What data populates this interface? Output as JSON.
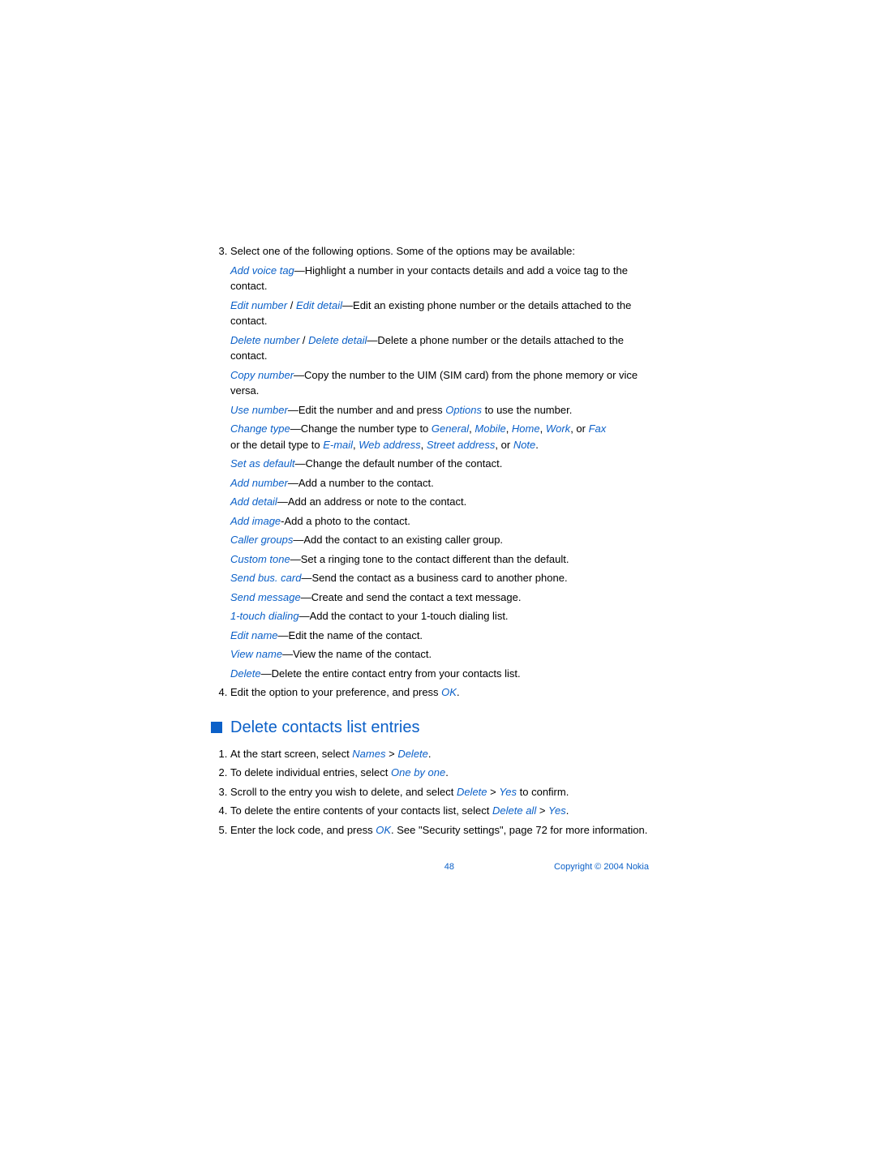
{
  "list3": {
    "intro": "Select one of the following options. Some of the options may be available:"
  },
  "options": [
    {
      "term": "Add voice tag",
      "desc": "—Highlight a number in your contacts details and add a voice tag to the contact."
    },
    {
      "term": "Edit number",
      "sep": " / ",
      "term2": "Edit detail",
      "desc": "—Edit an existing phone number or the details attached to the contact."
    },
    {
      "term": "Delete number",
      "sep": " / ",
      "term2": "Delete detail",
      "desc": "—Delete a phone number or the details attached to the contact."
    },
    {
      "term": "Copy number",
      "desc": "—Copy the number to the UIM (SIM card) from the phone memory or vice versa."
    },
    {
      "term": "Use number",
      "desc": "—Edit the number and and press ",
      "tail_blue_italic": "Options",
      "tail": " to use the number."
    },
    {
      "term": "Change type",
      "desc": "—Change the number type to ",
      "series": [
        "General",
        "Mobile",
        "Home",
        "Work"
      ],
      "series_last": "Fax",
      "line2_pre": "or the detail type to ",
      "series2": [
        "E-mail",
        "Web address",
        "Street address"
      ],
      "series2_last": "Note",
      "line2_post": "."
    },
    {
      "term": "Set as default",
      "desc": "—Change the default number of the contact."
    },
    {
      "term": "Add number",
      "desc": "—Add a number to the contact."
    },
    {
      "term": "Add detail",
      "desc": "—Add an address or note to the contact."
    },
    {
      "term": "Add image",
      "desc": "-Add a photo to the contact."
    },
    {
      "term": "Caller groups",
      "desc": "—Add the contact to an existing caller group."
    },
    {
      "term": "Custom tone",
      "desc": "—Set a ringing tone to the contact different than the default."
    },
    {
      "term": "Send bus. card",
      "desc": "—Send the contact as a business card to another phone."
    },
    {
      "term": "Send message",
      "desc": "—Create and send the contact a text message."
    },
    {
      "term": "1-touch dialing",
      "desc": "—Add the contact to your 1-touch dialing list."
    },
    {
      "term": "Edit name",
      "desc": "—Edit the name of the contact."
    },
    {
      "term": "View name",
      "desc": "—View the name of the contact."
    },
    {
      "term": "Delete",
      "desc": "—Delete the entire contact entry from your contacts list."
    }
  ],
  "list4": {
    "pre": "Edit the option to your preference, and press ",
    "ok": "OK",
    "post": "."
  },
  "section_heading": "Delete contacts list entries",
  "steps": [
    {
      "pre": "At the start screen, select ",
      "blue": "Names",
      "mid": " > ",
      "blue2": "Delete",
      "post": "."
    },
    {
      "pre": "To delete individual entries, select ",
      "blue": "One by one",
      "post": "."
    },
    {
      "pre": "Scroll to the entry you wish to delete, and select ",
      "blue": "Delete",
      "mid": " > ",
      "blue2": "Yes",
      "post": " to confirm."
    },
    {
      "pre": "To delete the entire contents of your contacts list, select ",
      "blue": "Delete all",
      "mid": " > ",
      "blue2": "Yes",
      "post": "."
    },
    {
      "pre": "Enter the lock code, and press ",
      "blue": "OK",
      "post": ". See \"Security settings\", page 72 for more information."
    }
  ],
  "footer": {
    "page": "48",
    "copyright": "Copyright © 2004 Nokia"
  }
}
